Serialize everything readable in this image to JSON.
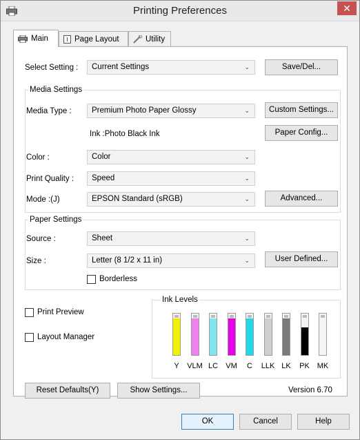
{
  "window": {
    "title": "Printing Preferences",
    "close_glyph": "✕"
  },
  "tabs": [
    {
      "label": "Main",
      "icon": "printer-icon"
    },
    {
      "label": "Page Layout",
      "icon": "page-layout-icon"
    },
    {
      "label": "Utility",
      "icon": "wrench-icon"
    }
  ],
  "select_setting": {
    "label": "Select Setting :",
    "value": "Current Settings",
    "button": "Save/Del..."
  },
  "media_settings": {
    "group_title": "Media Settings",
    "media_type_label": "Media Type :",
    "media_type_value": "Premium Photo Paper Glossy",
    "custom_settings_button": "Custom Settings...",
    "ink_text": "Ink :Photo Black Ink",
    "paper_config_button": "Paper Config...",
    "color_label": "Color :",
    "color_value": "Color",
    "print_quality_label": "Print Quality :",
    "print_quality_value": "Speed",
    "mode_label": "Mode :(J)",
    "mode_value": "EPSON Standard (sRGB)",
    "advanced_button": "Advanced..."
  },
  "paper_settings": {
    "group_title": "Paper Settings",
    "source_label": "Source :",
    "source_value": "Sheet",
    "size_label": "Size :",
    "size_value": "Letter (8 1/2 x 11 in)",
    "user_defined_button": "User Defined...",
    "borderless_label": "Borderless",
    "borderless_checked": false
  },
  "print_preview": {
    "label": "Print Preview",
    "checked": false
  },
  "layout_manager": {
    "label": "Layout Manager",
    "checked": false
  },
  "ink_levels": {
    "title": "Ink Levels",
    "inks": [
      {
        "name": "Y",
        "color": "#f5f000",
        "level": 0.88
      },
      {
        "name": "VLM",
        "color": "#ee82ee",
        "level": 0.88
      },
      {
        "name": "LC",
        "color": "#7fe6f0",
        "level": 0.88
      },
      {
        "name": "VM",
        "color": "#e600e6",
        "level": 0.88
      },
      {
        "name": "C",
        "color": "#22d8e6",
        "level": 0.88
      },
      {
        "name": "LLK",
        "color": "#cfcfcf",
        "level": 0.88
      },
      {
        "name": "LK",
        "color": "#7a7a7a",
        "level": 0.88
      },
      {
        "name": "PK",
        "color": "#000000",
        "level": 0.66
      },
      {
        "name": "MK",
        "color": "#f4f4f4",
        "level": 0.0
      }
    ]
  },
  "footer": {
    "reset_defaults_button": "Reset Defaults(Y)",
    "show_settings_button": "Show Settings...",
    "version": "Version 6.70"
  },
  "dialog_buttons": {
    "ok": "OK",
    "cancel": "Cancel",
    "help": "Help"
  }
}
